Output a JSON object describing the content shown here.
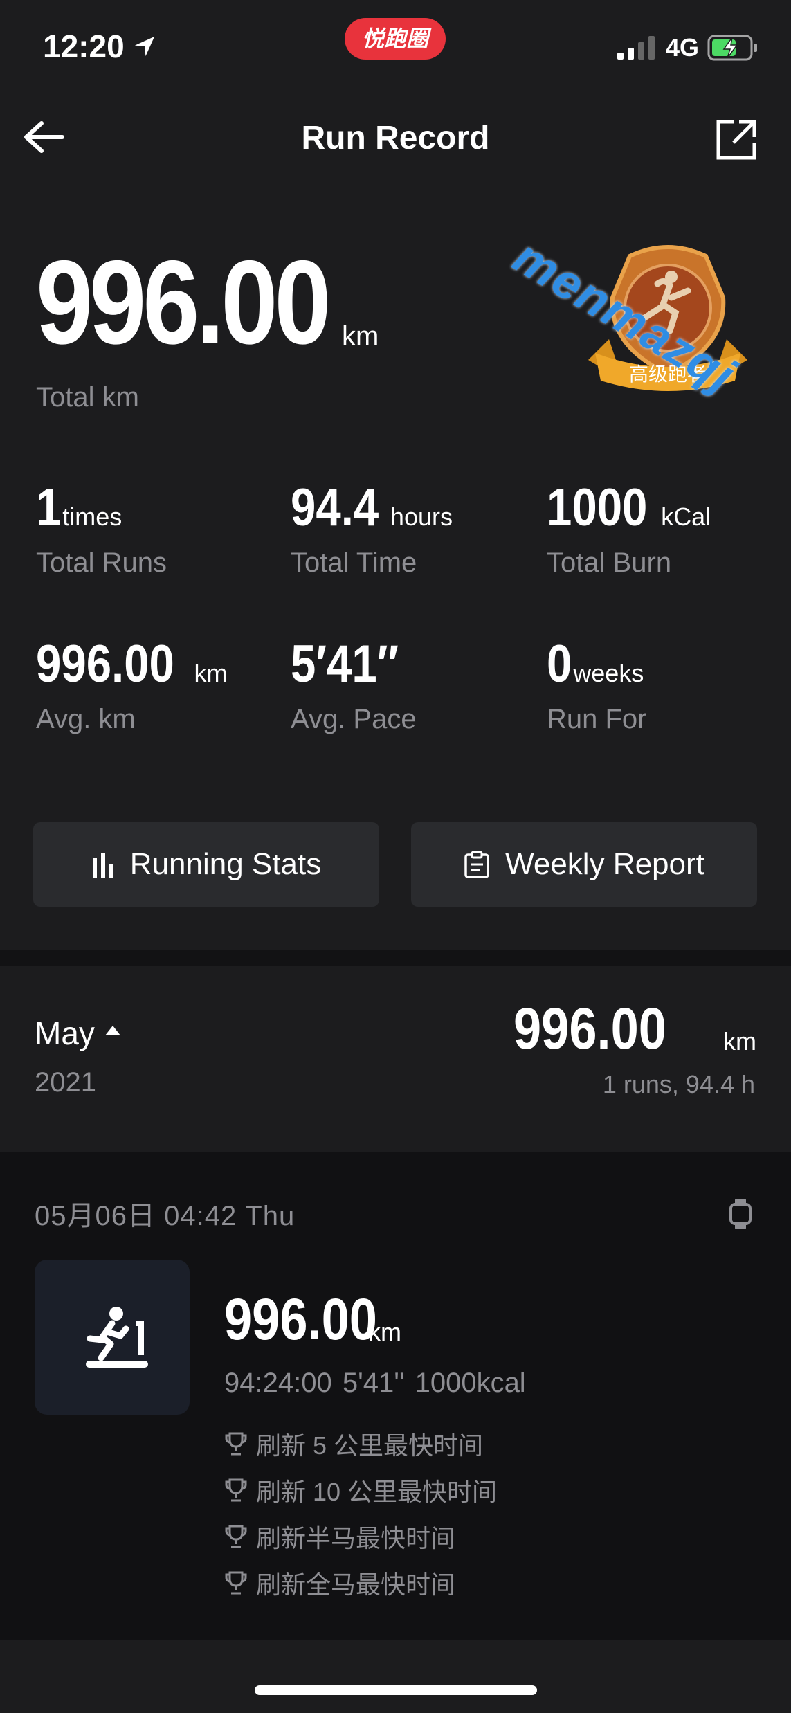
{
  "status_bar": {
    "time": "12:20",
    "network": "4G",
    "app_badge": "悦跑圈"
  },
  "header": {
    "title": "Run Record"
  },
  "watermark": "menmazqj",
  "medal": {
    "label": "高级跑者"
  },
  "summary": {
    "total_km": "996.00",
    "total_km_unit": "km",
    "total_km_label": "Total km"
  },
  "stats": [
    {
      "value": "1",
      "unit": "times",
      "label": "Total Runs"
    },
    {
      "value": "94.4",
      "unit": "hours",
      "label": "Total Time"
    },
    {
      "value": "1000",
      "unit": "kCal",
      "label": "Total Burn"
    },
    {
      "value": "996.00",
      "unit": "km",
      "label": "Avg. km"
    },
    {
      "value": "5′41″",
      "unit": "",
      "label": "Avg. Pace"
    },
    {
      "value": "0",
      "unit": "weeks",
      "label": "Run For"
    }
  ],
  "buttons": {
    "running_stats": "Running Stats",
    "weekly_report": "Weekly Report"
  },
  "month_section": {
    "month": "May",
    "year": "2021",
    "km": "996.00",
    "km_unit": "km",
    "sub": "1 runs, 94.4 h"
  },
  "run": {
    "date": "05月06日  04:42  Thu",
    "km": "996.00",
    "km_unit": "km",
    "meta": "94:24:00  5'41''  1000kcal",
    "achievements": [
      "刷新 5 公里最快时间",
      "刷新 10 公里最快时间",
      "刷新半马最快时间",
      "刷新全马最快时间"
    ]
  },
  "colors": {
    "background": "#1c1c1e",
    "panel_dark": "#111113",
    "muted_text": "#8e8e93",
    "badge_red": "#e8333c",
    "battery_green": "#4cd964"
  }
}
